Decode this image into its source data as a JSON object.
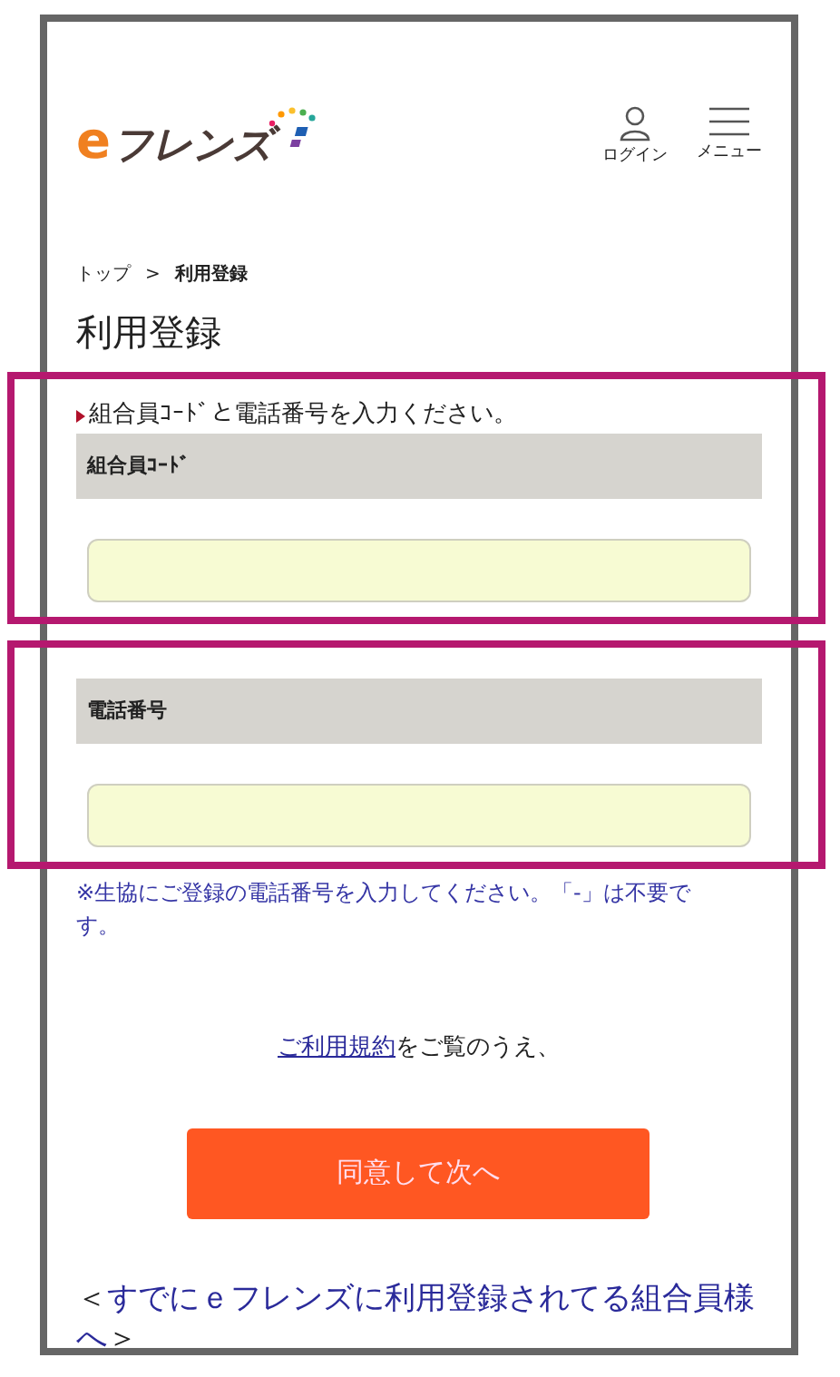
{
  "header": {
    "logo": {
      "letter": "e",
      "text": "フレンズ"
    },
    "actions": [
      {
        "label": "ログイン",
        "kind": "user"
      },
      {
        "label": "メニュー",
        "kind": "menu"
      }
    ]
  },
  "breadcrumb": {
    "separator": ">",
    "items": [
      {
        "label": "トップ",
        "current": false
      },
      {
        "label": "利用登録",
        "current": true
      }
    ]
  },
  "title": "利用登録",
  "fields": [
    {
      "instruction": "組合員ｺｰﾄﾞと電話番号を入力ください。",
      "label": "組合員ｺｰﾄﾞ",
      "highlighted": true
    },
    {
      "label": "電話番号",
      "highlighted": true,
      "note": "※生協にご登録の電話番号を入力してください。「-」は不要です。"
    }
  ],
  "terms": {
    "link": "ご利用規約",
    "text": "をご覧のうえ、"
  },
  "submit_button": "同意して次へ",
  "existing_link": {
    "open": "＜",
    "text": "すでにｅフレンズに利用登録されてる組合員様へ",
    "close": "＞"
  }
}
